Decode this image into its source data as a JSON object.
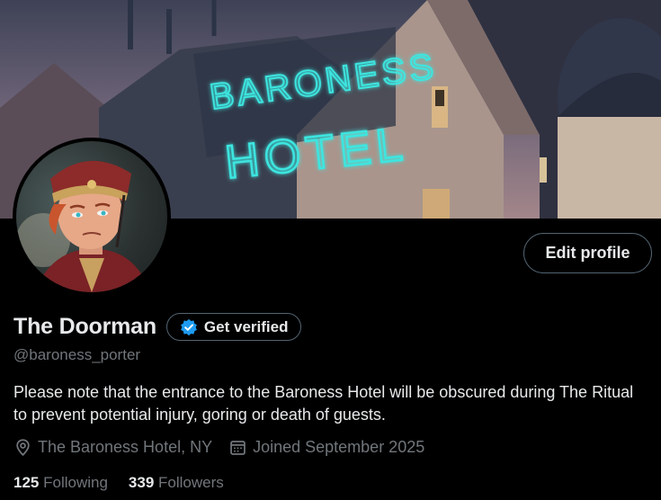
{
  "banner": {
    "sign_line1": "BARONESS",
    "sign_line2": "HOTEL"
  },
  "profile": {
    "display_name": "The Doorman",
    "handle": "@baroness_porter",
    "bio": "Please note that the entrance to the Baroness Hotel will be obscured during The Ritual to prevent potential injury, goring or death of guests.",
    "location": "The Baroness Hotel, NY",
    "joined": "Joined September 2025"
  },
  "buttons": {
    "edit_profile": "Edit profile",
    "get_verified": "Get verified"
  },
  "stats": {
    "following_count": "125",
    "following_label": "Following",
    "followers_count": "339",
    "followers_label": "Followers"
  },
  "colors": {
    "background": "#000000",
    "primary_text": "#e7e9ea",
    "secondary_text": "#71767b",
    "border": "#536471",
    "verified_blue": "#1d9bf0",
    "neon_sign": "#3ee6e0"
  },
  "icons": {
    "location": "location-pin-icon",
    "joined": "calendar-icon",
    "verified": "verified-badge-icon"
  }
}
